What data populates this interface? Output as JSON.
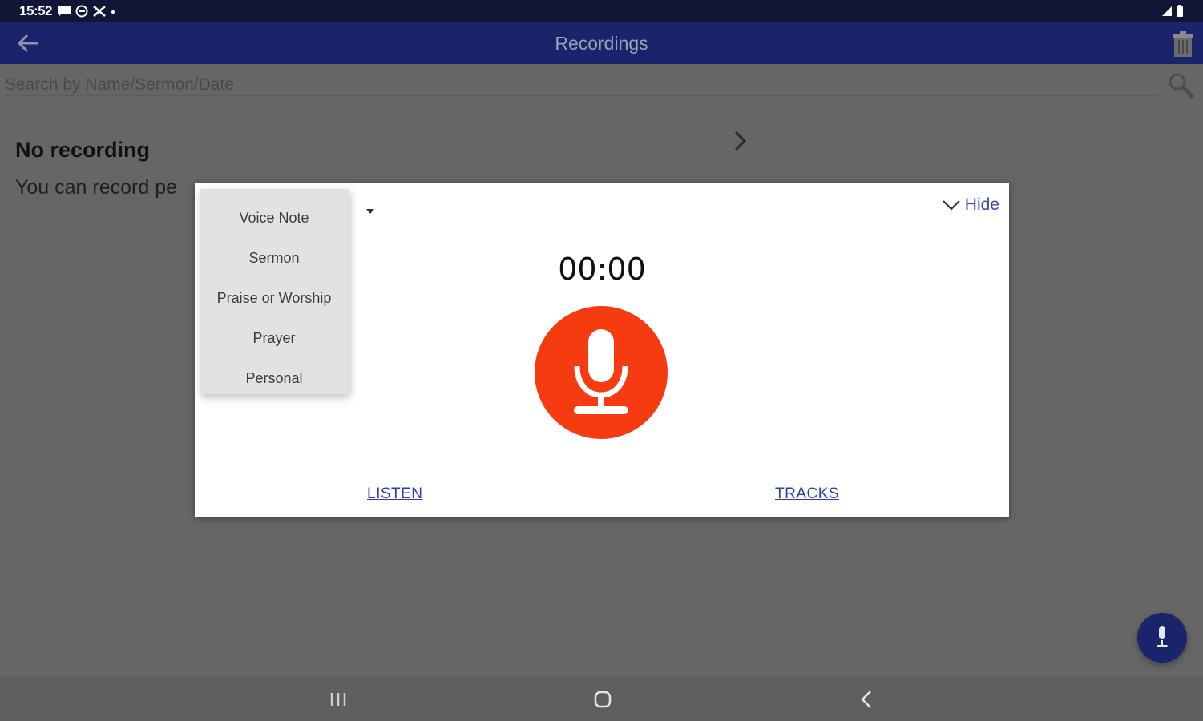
{
  "status_bar": {
    "time": "15:52"
  },
  "app_bar": {
    "title": "Recordings"
  },
  "search": {
    "placeholder": "Search by Name/Sermon/Date"
  },
  "empty_state": {
    "title": "No recording",
    "description": "You can record pe"
  },
  "dialog": {
    "recording_types": [
      "Voice Note",
      "Sermon",
      "Praise or Worship",
      "Prayer",
      "Personal"
    ],
    "hide_label": "Hide",
    "timer": "00:00",
    "listen_label": "LISTEN",
    "tracks_label": "TRACKS"
  },
  "icons": {
    "back": "arrow-left-icon",
    "delete": "trash-icon",
    "search": "magnifier-icon",
    "mic": "microphone-icon",
    "fab": "microphone-icon"
  },
  "colors": {
    "app_bar": "#1a246a",
    "status_bar": "#101636",
    "mic_button": "#f63b10",
    "link": "#2d3db0",
    "scrim_background": "#666666"
  }
}
